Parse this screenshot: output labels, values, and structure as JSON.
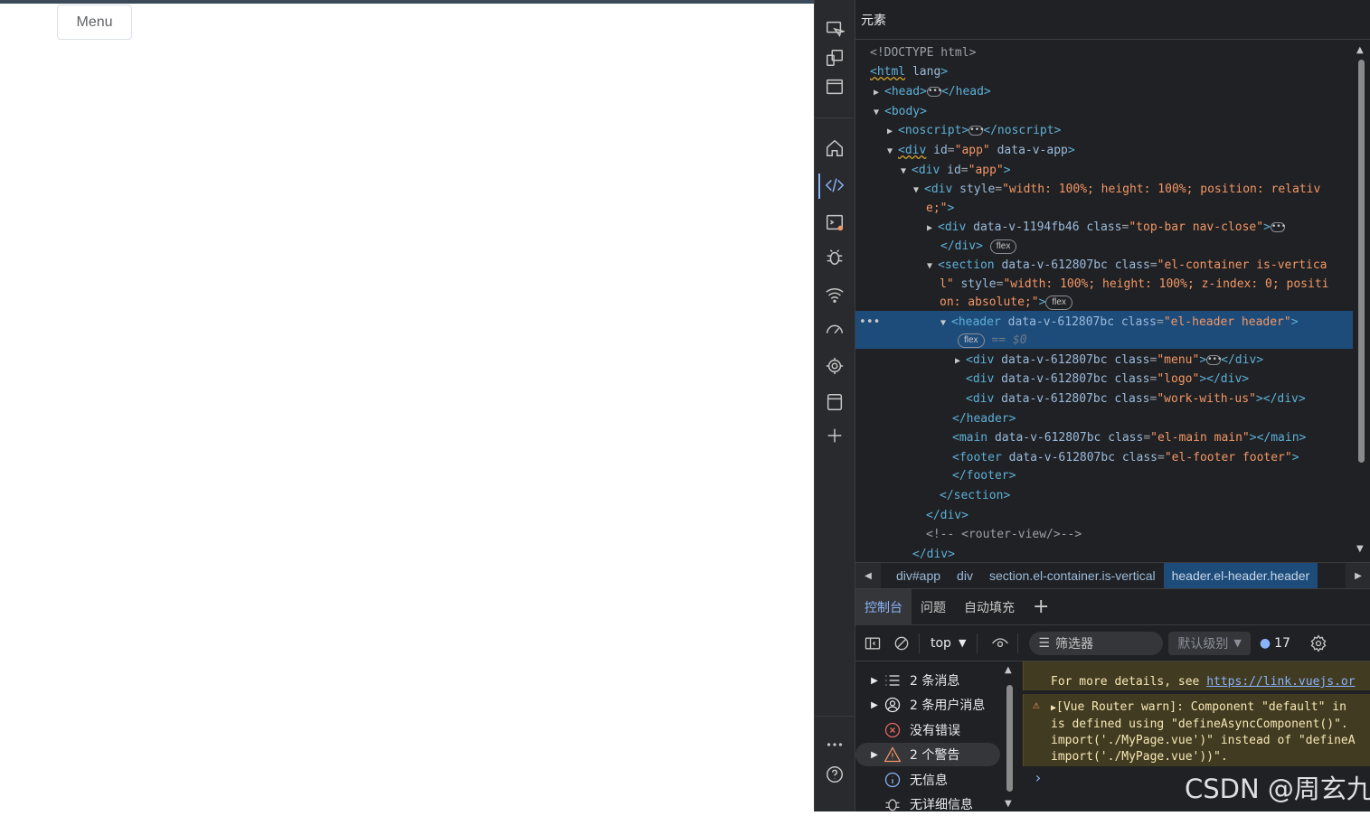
{
  "page": {
    "menu_button": "Menu"
  },
  "devtools": {
    "activity_icons": [
      "inspect-icon",
      "device-toggle-icon",
      "dock-icon",
      "home-icon",
      "elements-icon",
      "console-icon",
      "sources-icon",
      "network-icon",
      "performance-icon",
      "memory-icon",
      "application-icon",
      "add-tool-icon",
      "more-tools-icon",
      "help-icon"
    ],
    "elements": {
      "title": "元素",
      "dom": {
        "l0": "<!DOCTYPE html>",
        "l1_tag": "<html",
        "l1_attr": "lang",
        "l1_close": ">",
        "l2": "<head>",
        "l2_end": "</head>",
        "l3": "<body>",
        "l4": "<noscript>",
        "l4_end": "</noscript>",
        "l5_tag": "<div",
        "l5_a1": "id",
        "l5_v1": "\"app\"",
        "l5_a2": "data-v-app",
        "l5_close": ">",
        "l6_tag": "<div",
        "l6_a1": "id",
        "l6_v1": "\"app\"",
        "l6_close": ">",
        "l7_tag": "<div",
        "l7_a1": "style",
        "l7_v1": "\"width: 100%; height: 100%; position: relativ",
        "l7b_v": "e;\"",
        "l7b_close": ">",
        "l8_tag": "<div",
        "l8_a1": "data-v-1194fb46",
        "l8_a2": "class",
        "l8_v2": "\"top-bar nav-close\"",
        "l8_close": ">",
        "l8b": "</div>",
        "l8b_pill": "flex",
        "l9_tag": "<section",
        "l9_a1": "data-v-612807bc",
        "l9_a2": "class",
        "l9_v2": "\"el-container is-vertica",
        "l9b_v": "l\"",
        "l9b_a": "style",
        "l9b_v2": "\"width: 100%; height: 100%; z-index: 0; positi",
        "l9c_v": "on: absolute;\"",
        "l9c_close": ">",
        "l9c_pill": "flex",
        "l10_tag": "<header",
        "l10_a1": "data-v-612807bc",
        "l10_a2": "class",
        "l10_v2": "\"el-header header\"",
        "l10_close": ">",
        "l10b_pill": "flex",
        "l10b_ref": "== $0",
        "l11_tag": "<div",
        "l11_a1": "data-v-612807bc",
        "l11_a2": "class",
        "l11_v2": "\"menu\"",
        "l11_close": ">",
        "l11_end": "</div>",
        "l12_tag": "<div",
        "l12_a1": "data-v-612807bc",
        "l12_a2": "class",
        "l12_v2": "\"logo\"",
        "l12_end": "></div>",
        "l13_tag": "<div",
        "l13_a1": "data-v-612807bc",
        "l13_a2": "class",
        "l13_v2": "\"work-with-us\"",
        "l13_end": "></div>",
        "l14": "</header>",
        "l15_tag": "<main",
        "l15_a1": "data-v-612807bc",
        "l15_a2": "class",
        "l15_v2": "\"el-main main\"",
        "l15_end": "></main>",
        "l16_tag": "<footer",
        "l16_a1": "data-v-612807bc",
        "l16_a2": "class",
        "l16_v2": "\"el-footer footer\"",
        "l16_close": ">",
        "l17": "</footer>",
        "l18": "</section>",
        "l19": "</div>",
        "l20": "<!--        <router-view/>-->",
        "l21": "</div>"
      },
      "breadcrumbs": [
        "div#app",
        "div",
        "section.el-container.is-vertical",
        "header.el-header.header"
      ]
    },
    "console": {
      "tabs": [
        "控制台",
        "问题",
        "自动填充"
      ],
      "context": "top",
      "filter_placeholder": "筛选器",
      "level": "默认级别",
      "message_count": "17",
      "sidebar": [
        {
          "label": "2 条消息",
          "icon": "list-icon"
        },
        {
          "label": "2 条用户消息",
          "icon": "user-icon"
        },
        {
          "label": "没有错误",
          "icon": "error-icon"
        },
        {
          "label": "2 个警告",
          "icon": "warning-icon"
        },
        {
          "label": "无信息",
          "icon": "info-icon"
        },
        {
          "label": "无详细信息",
          "icon": "verbose-icon"
        }
      ],
      "log": {
        "line1_text": "For more details, see ",
        "line1_link": "https://link.vuejs.or",
        "warn_line1": "[Vue Router warn]: Component \"default\" in",
        "warn_line2": "is defined using \"defineAsyncComponent()\".",
        "warn_line3": "import('./MyPage.vue')\" instead of \"defineA",
        "warn_line4": "import('./MyPage.vue'))\"."
      }
    }
  },
  "watermark": "CSDN @周玄九",
  "colors": {
    "selected_row": "#1d4b7a",
    "tag": "#5db0d7",
    "attr_value": "#f29766",
    "warning_bg": "#413b22"
  }
}
